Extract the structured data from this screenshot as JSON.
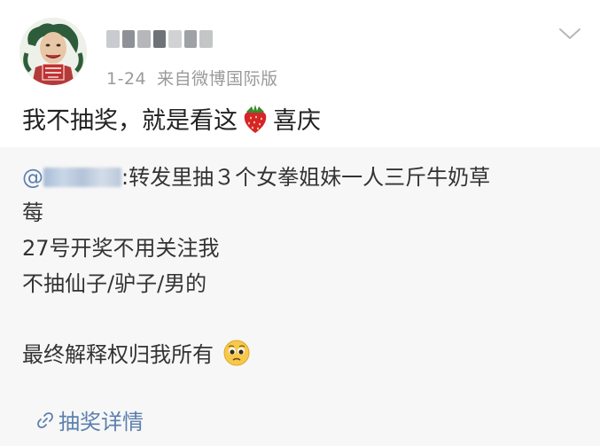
{
  "post": {
    "meta": {
      "date": "1-24",
      "source": "来自微博国际版"
    },
    "text_before_emoji": "我不抽奖，就是看这",
    "text_after_emoji": "喜庆"
  },
  "repost": {
    "prefix": "@",
    "first_line_suffix": ":转发里抽３个女拳姐妹一人三斤牛奶草",
    "wrap_line": "莓",
    "lines": [
      "27号开奖不用关注我",
      "不抽仙子/驴子/男的"
    ],
    "last_line": "最终解释权归我所有",
    "lottery_link": "抽奖详情"
  },
  "icons": {
    "avatar": "avatar-illustration",
    "emoji_1": "strawberry-icon",
    "emoji_2": "pleading-face-icon",
    "more": "chevron-down-icon",
    "link": "link-icon"
  },
  "colors": {
    "link": "#5c7fae",
    "meta": "#9a9a9a",
    "repost_bg": "#f7f7f7"
  }
}
